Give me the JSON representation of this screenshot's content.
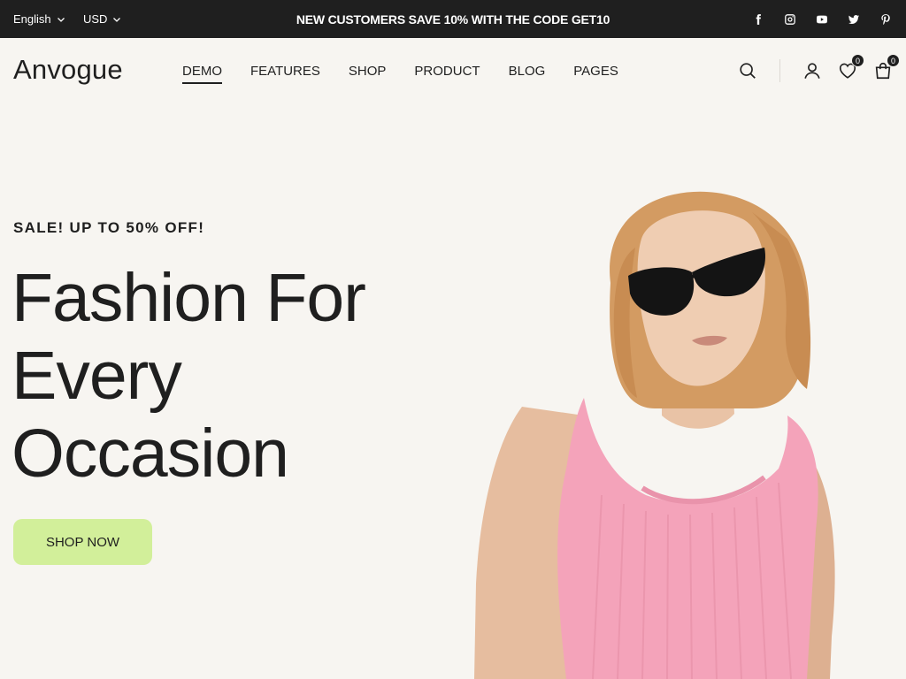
{
  "topbar": {
    "language": "English",
    "currency": "USD",
    "promo": "NEW CUSTOMERS SAVE 10% WITH THE CODE GET10",
    "socials": [
      "facebook-icon",
      "instagram-icon",
      "youtube-icon",
      "twitter-icon",
      "pinterest-icon"
    ]
  },
  "header": {
    "logo": "Anvogue",
    "nav": [
      {
        "label": "DEMO",
        "active": true
      },
      {
        "label": "FEATURES",
        "active": false
      },
      {
        "label": "SHOP",
        "active": false
      },
      {
        "label": "PRODUCT",
        "active": false
      },
      {
        "label": "BLOG",
        "active": false
      },
      {
        "label": "PAGES",
        "active": false
      }
    ],
    "icons": [
      "search-icon",
      "user-icon",
      "heart-icon",
      "cart-icon"
    ],
    "wishlist_count": "0",
    "cart_count": "0"
  },
  "hero": {
    "sale_text": "SALE! UP TO 50% OFF!",
    "title_lines": [
      "Fashion For",
      "Every",
      "Occasion"
    ],
    "button_label": "SHOP NOW"
  },
  "colors": {
    "topbar_bg": "#1f1f1f",
    "page_bg": "#f7f5f1",
    "button_bg": "#d2ef9a",
    "text": "#1f1f1f"
  }
}
